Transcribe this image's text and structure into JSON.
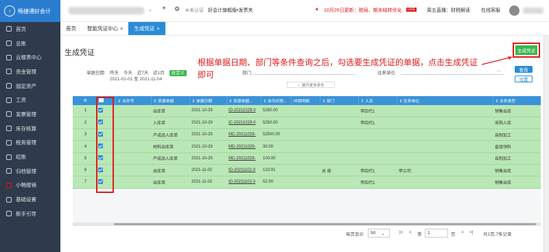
{
  "app": {
    "logo_text": "畅捷通好会计"
  },
  "topbar": {
    "plus_icon": "+",
    "cert_text": "⊕未认证",
    "tag_text": "好会计旗舰版•发票夹",
    "notice": "10月26日更新：税局、期末结转优化",
    "live_text": "周五直播：财税解读",
    "online_text": "在线客服",
    "accent": "#e0191b"
  },
  "sidebar": {
    "items": [
      {
        "label": "首页"
      },
      {
        "label": "总账"
      },
      {
        "label": "云报表中心"
      },
      {
        "label": "资金管理"
      },
      {
        "label": "固定资产"
      },
      {
        "label": "工资"
      },
      {
        "label": "发票管理"
      },
      {
        "label": "库存核算"
      },
      {
        "label": "税务管理"
      },
      {
        "label": "结账"
      },
      {
        "label": "归档管理"
      },
      {
        "label": "小畅报销"
      },
      {
        "label": "基础设置"
      },
      {
        "label": "新手引导"
      }
    ]
  },
  "tabs": [
    {
      "label": "首页",
      "close": ""
    },
    {
      "label": "智能凭证中心",
      "close": "×"
    },
    {
      "label": "生成凭证",
      "close": "×"
    }
  ],
  "page": {
    "title": "生成凭证",
    "note": "根据单据日期、部门等条件查询之后，勾选要生成凭证的单据，点击生成凭证即可",
    "gen_button": "生成凭证",
    "filter": {
      "date_label": "单据日期",
      "date_options": [
        "昨天",
        "今天",
        "近7天",
        "近1月"
      ],
      "custom_label": "自定义",
      "date_range": "2021-01-01 至 2021-11-04",
      "dept_label": "部门",
      "partner_label": "往来单位",
      "more_icon": "...",
      "query_button": "查询",
      "reset_button": "设置",
      "expand_label": "展开更多条件"
    }
  },
  "table": {
    "columns": [
      "⚙",
      "☑",
      "合并号",
      "来源单据",
      "单据日期",
      "来源单据...",
      "本币价税...",
      "冲销明细",
      "部门",
      "人员",
      "往来单位",
      "业务类型"
    ],
    "rows": [
      {
        "n": "1",
        "src": "出库单",
        "date": "2021-10-29",
        "code": "ID-20211029-0",
        "amt": "5250.00",
        "dept": "",
        "person": "李四代1",
        "partner": "",
        "type": "销售出库"
      },
      {
        "n": "2",
        "src": "入库单",
        "date": "2021-10-29",
        "code": "IC-20211029-0",
        "amt": "5250.00",
        "dept": "",
        "person": "李四代1",
        "partner": "",
        "type": "采购入库"
      },
      {
        "n": "3",
        "src": "产成品入库单",
        "date": "2021-10-29",
        "code": "MC-20211029-",
        "amt": "52500.00",
        "dept": "",
        "person": "",
        "partner": "",
        "type": "自制加工"
      },
      {
        "n": "4",
        "src": "材料出库单",
        "date": "2021-10-29",
        "code": "MD-20211029-",
        "amt": "30.00",
        "dept": "",
        "person": "",
        "partner": "",
        "type": "直接领料"
      },
      {
        "n": "5",
        "src": "产成品入库单",
        "date": "2021-10-29",
        "code": "MC-20211029-",
        "amt": "100.00",
        "dept": "",
        "person": "",
        "partner": "",
        "type": "自制加工"
      },
      {
        "n": "6",
        "src": "出库单",
        "date": "2021-11-02",
        "code": "ID-20211102-0",
        "amt": "123.91",
        "dept": "总 部",
        "person": "李四代1",
        "partner": "甲公司",
        "type": "销售出库"
      },
      {
        "n": "7",
        "src": "出库单",
        "date": "2021-11-02",
        "code": "ID-20211102-0",
        "amt": "52.50",
        "dept": "",
        "person": "李四代1",
        "partner": "",
        "type": "销售出库"
      }
    ]
  },
  "pager": {
    "per_page_label": "每页显示",
    "per_page": "50",
    "first_icon": "|<",
    "prev_icon": "<",
    "page_prefix": "第",
    "page": "1",
    "page_suffix": "页",
    "next_icon": ">",
    "last_icon": ">|",
    "summary": "共1页,7条记录"
  }
}
